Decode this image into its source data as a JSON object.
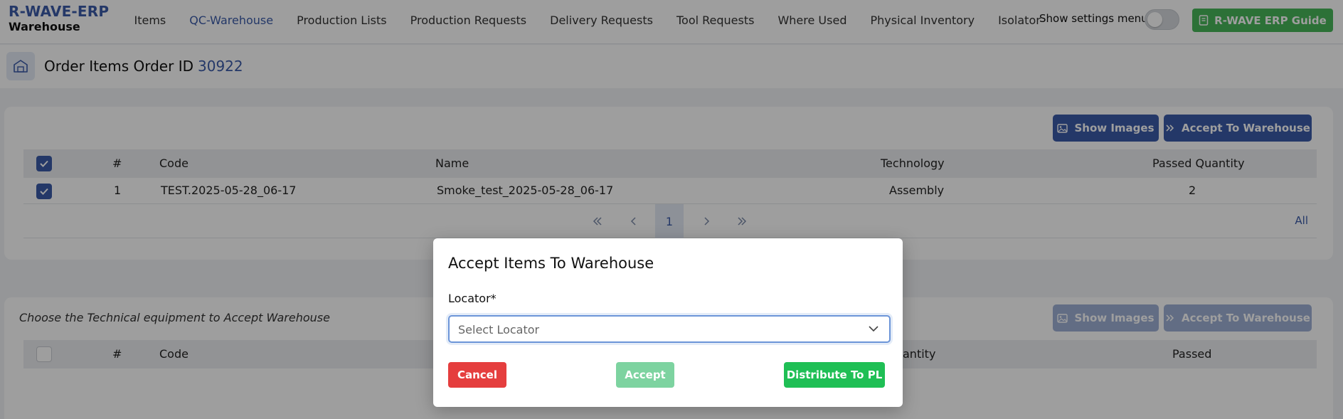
{
  "brand": {
    "title": "R-WAVE-ERP",
    "subtitle": "Warehouse"
  },
  "nav": {
    "items": [
      {
        "label": "Items",
        "active": false
      },
      {
        "label": "QC-Warehouse",
        "active": true
      },
      {
        "label": "Production Lists",
        "active": false
      },
      {
        "label": "Production Requests",
        "active": false
      },
      {
        "label": "Delivery Requests",
        "active": false
      },
      {
        "label": "Tool Requests",
        "active": false
      },
      {
        "label": "Where Used",
        "active": false
      },
      {
        "label": "Physical Inventory",
        "active": false
      },
      {
        "label": "Isolator",
        "active": false
      }
    ],
    "settings_label": "Show settings menu",
    "guide_label": "R-WAVE ERP Guide"
  },
  "page": {
    "title": "Order Items Order ID",
    "order_id": "30922"
  },
  "card1": {
    "show_images_label": "Show Images",
    "accept_label": "Accept To Warehouse",
    "columns": [
      "#",
      "Code",
      "Name",
      "Technology",
      "Passed Quantity"
    ],
    "rows": [
      {
        "num": "1",
        "code": "TEST.2025-05-28_06-17",
        "name": "Smoke_test_2025-05-28_06-17",
        "technology": "Assembly",
        "passed_quantity": "2"
      }
    ],
    "pager": {
      "current": "1",
      "all_label": "All"
    }
  },
  "card2": {
    "note": "Choose the Technical equipment to Accept Warehouse",
    "show_images_label": "Show Images",
    "accept_label": "Accept To Warehouse",
    "columns": [
      "#",
      "Code",
      "antity",
      "Passed"
    ]
  },
  "modal": {
    "title": "Accept Items To Warehouse",
    "locator_label": "Locator*",
    "locator_placeholder": "Select Locator",
    "cancel_label": "Cancel",
    "accept_label": "Accept",
    "distribute_label": "Distribute To PL"
  },
  "colors": {
    "primary": "#3b5ba9",
    "success": "#48b65a",
    "danger": "#e53e3e",
    "distribute": "#1fbf55"
  }
}
